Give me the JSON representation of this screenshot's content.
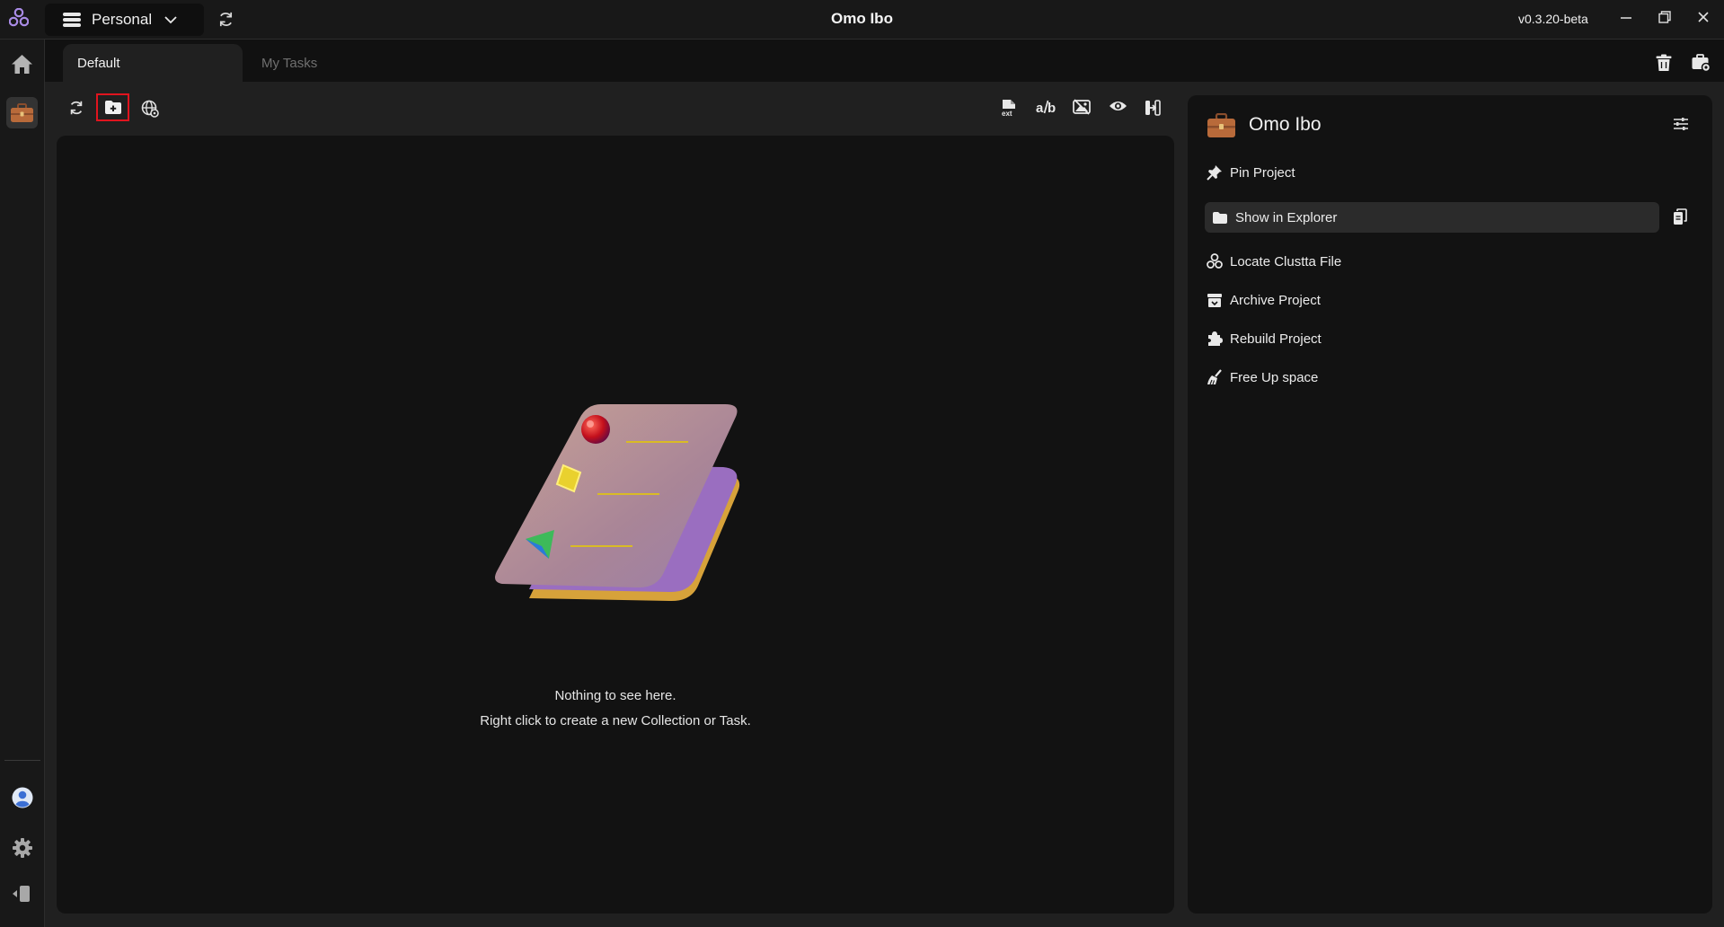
{
  "app": {
    "title": "Omo Ibo",
    "version": "v0.3.20-beta",
    "workspace": "Personal"
  },
  "tabs": [
    {
      "label": "Default",
      "active": true
    },
    {
      "label": "My Tasks",
      "active": false
    }
  ],
  "empty_state": {
    "line1": "Nothing to see here.",
    "line2": "Right click to create a new Collection or Task."
  },
  "side_panel": {
    "title": "Omo Ibo",
    "actions": [
      {
        "label": "Pin Project",
        "icon": "pin-icon"
      },
      {
        "label": "Show in Explorer",
        "icon": "folder-icon",
        "highlighted": true
      },
      {
        "label": "Locate Clustta File",
        "icon": "clustta-logo-icon"
      },
      {
        "label": "Archive Project",
        "icon": "archive-icon"
      },
      {
        "label": "Rebuild Project",
        "icon": "puzzle-icon"
      },
      {
        "label": "Free Up space",
        "icon": "broom-icon"
      }
    ]
  },
  "colors": {
    "background": "#161616",
    "panel": "#121212",
    "toolbar": "#202020",
    "highlight_box": "#e0141e",
    "briefcase": "#b86a3a"
  }
}
